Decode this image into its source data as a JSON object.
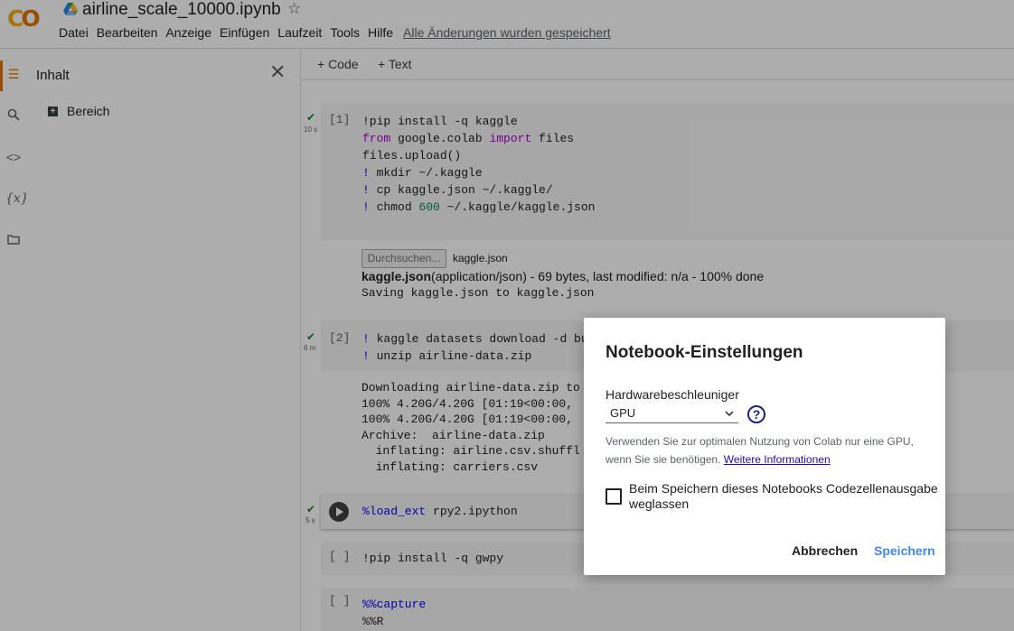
{
  "header": {
    "title": "airline_scale_10000.ipynb",
    "menu": [
      "Datei",
      "Bearbeiten",
      "Anzeige",
      "Einfügen",
      "Laufzeit",
      "Tools",
      "Hilfe"
    ],
    "saved_status": "Alle Änderungen wurden gespeichert"
  },
  "sidebar": {
    "title": "Inhalt",
    "section": "Bereich"
  },
  "toolbar": {
    "code_label": "+ Code",
    "text_label": "+ Text"
  },
  "cells": [
    {
      "number": "[1]",
      "time": "10 s"
    },
    {
      "number": "[2]",
      "time": "6 m"
    },
    {
      "number": "",
      "time": "5 s"
    },
    {
      "number": "[ ]",
      "time": ""
    },
    {
      "number": "[ ]",
      "time": ""
    }
  ],
  "upload": {
    "browse_label": "Durchsuchen...",
    "filename": "kaggle.json",
    "info_bold": "kaggle.json",
    "info_rest": "(application/json) - 69 bytes, last modified: n/a - 100% done",
    "saving": "Saving kaggle.json to kaggle.json"
  },
  "outputs": {
    "cell2_lines": "Downloading airline-data.zip to\n100% 4.20G/4.20G [01:19<00:00,\n100% 4.20G/4.20G [01:19<00:00,\nArchive:  airline-data.zip\n  inflating: airline.csv.shuffl\n  inflating: carriers.csv"
  },
  "dialog": {
    "title": "Notebook-Einstellungen",
    "hw_label": "Hardwarebeschleuniger",
    "hw_value": "GPU",
    "desc_text": "Verwenden Sie zur optimalen Nutzung von Colab nur eine GPU, wenn Sie sie benötigen.",
    "desc_link": "Weitere Informationen",
    "checkbox_label": "Beim Speichern dieses Notebooks Codezellenausgabe weglassen",
    "cancel_label": "Abbrechen",
    "save_label": "Speichern"
  },
  "colors": {
    "accent": "#e37400",
    "logo_yellow": "#f9ab00",
    "save_blue": "#4285f4",
    "check_green": "#188038"
  }
}
